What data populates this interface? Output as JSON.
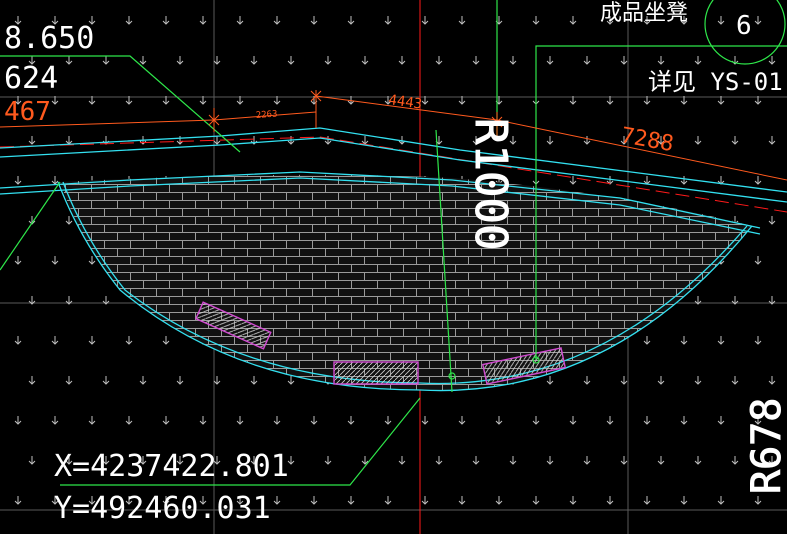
{
  "elevations": [
    "8.650",
    "624",
    "467"
  ],
  "dimensions": [
    "2263",
    "4443",
    "7288"
  ],
  "radius_label": "R1000",
  "radius_label_right": "R678",
  "callout": {
    "title": "成品坐凳",
    "number": "6",
    "detail": "详见 YS-01"
  },
  "coordinates": {
    "x": "X=4237422.801",
    "y": "Y=492460.031"
  },
  "colors": {
    "background": "#000000",
    "grid": "#5a5a5a",
    "cyan": "#33e0f0",
    "green": "#2ee64a",
    "red": "#ff1a1a",
    "orange": "#ff5a1e",
    "magenta": "#d24bd2",
    "brick": "#9a9a9a"
  }
}
